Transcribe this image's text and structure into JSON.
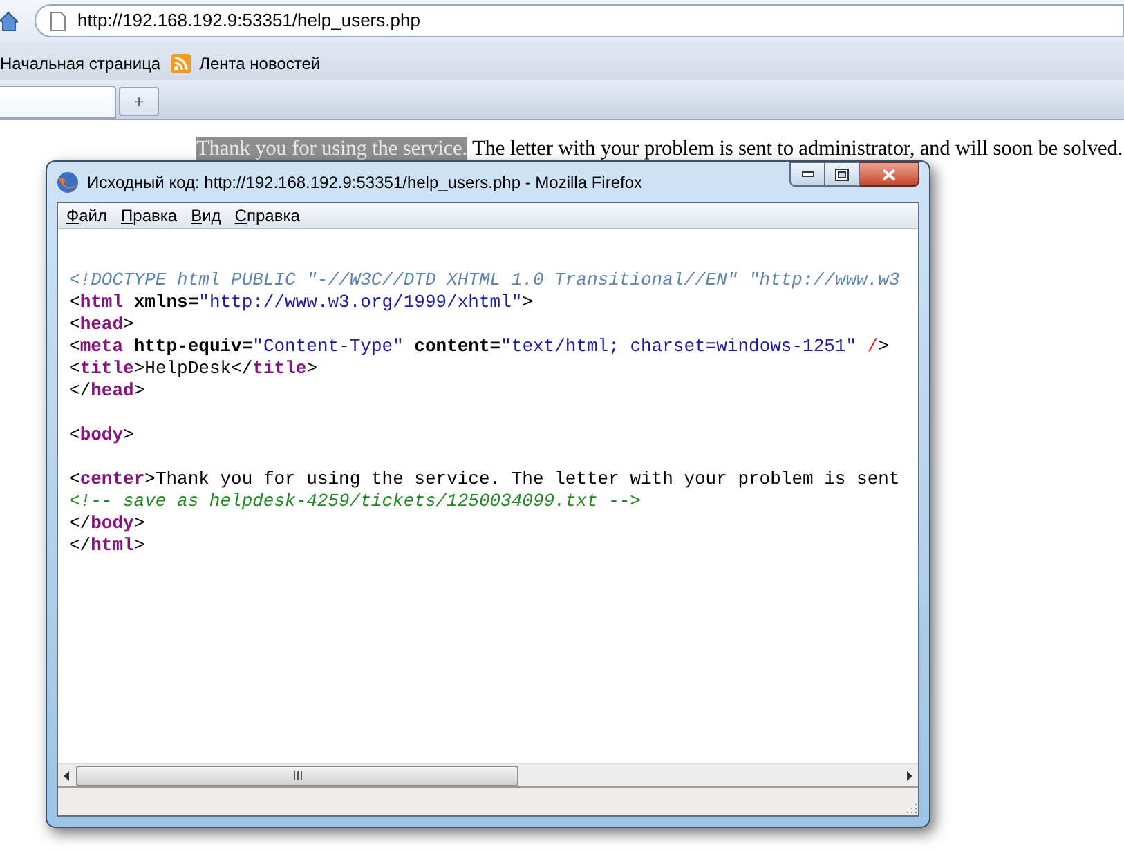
{
  "browser": {
    "address": "http://192.168.192.9:53351/help_users.php",
    "bookmarks": [
      "Начальная страница",
      "Лента новостей"
    ],
    "new_tab": "+"
  },
  "page": {
    "selected_text": "Thank you for using the service.",
    "text": "The letter with your problem is sent to administrator, and will soon be solved."
  },
  "source_window": {
    "title": "Исходный код: http://192.168.192.9:53351/help_users.php - Mozilla Firefox",
    "menu": [
      "Файл",
      "Правка",
      "Вид",
      "Справка"
    ],
    "lines": [
      {
        "kind": "blank"
      },
      {
        "kind": "code",
        "tokens": [
          {
            "kind": "doctype",
            "text": "<!DOCTYPE html PUBLIC \"-//W3C//DTD XHTML 1.0 Transitional//EN\" \"http://www.w3"
          }
        ]
      },
      {
        "kind": "code",
        "tokens": [
          {
            "kind": "punct",
            "text": "<"
          },
          {
            "kind": "tag",
            "text": "html"
          },
          {
            "kind": "attr",
            "text": " xmlns="
          },
          {
            "kind": "value",
            "text": "\"http://www.w3.org/1999/xhtml\""
          },
          {
            "kind": "punct",
            "text": ">"
          }
        ]
      },
      {
        "kind": "code",
        "tokens": [
          {
            "kind": "punct",
            "text": "<"
          },
          {
            "kind": "tag",
            "text": "head"
          },
          {
            "kind": "punct",
            "text": ">"
          }
        ]
      },
      {
        "kind": "code",
        "tokens": [
          {
            "kind": "punct",
            "text": "<"
          },
          {
            "kind": "tag",
            "text": "meta"
          },
          {
            "kind": "attr",
            "text": " http-equiv="
          },
          {
            "kind": "value",
            "text": "\"Content-Type\""
          },
          {
            "kind": "attr",
            "text": " content="
          },
          {
            "kind": "value",
            "text": "\"text/html; charset=windows-1251\""
          },
          {
            "kind": "error",
            "text": " /"
          },
          {
            "kind": "punct",
            "text": ">"
          }
        ]
      },
      {
        "kind": "code",
        "tokens": [
          {
            "kind": "punct",
            "text": "<"
          },
          {
            "kind": "tag",
            "text": "title"
          },
          {
            "kind": "punct",
            "text": ">"
          },
          {
            "kind": "text",
            "text": "HelpDesk"
          },
          {
            "kind": "punct",
            "text": "</"
          },
          {
            "kind": "tag",
            "text": "title"
          },
          {
            "kind": "punct",
            "text": ">"
          }
        ]
      },
      {
        "kind": "code",
        "tokens": [
          {
            "kind": "punct",
            "text": "</"
          },
          {
            "kind": "tag",
            "text": "head"
          },
          {
            "kind": "punct",
            "text": ">"
          }
        ]
      },
      {
        "kind": "blank"
      },
      {
        "kind": "code",
        "tokens": [
          {
            "kind": "punct",
            "text": "<"
          },
          {
            "kind": "tag",
            "text": "body"
          },
          {
            "kind": "punct",
            "text": ">"
          }
        ]
      },
      {
        "kind": "blank"
      },
      {
        "kind": "code",
        "tokens": [
          {
            "kind": "punct",
            "text": "<"
          },
          {
            "kind": "tag",
            "text": "center"
          },
          {
            "kind": "punct",
            "text": ">"
          },
          {
            "kind": "text",
            "text": "Thank you for using the service. The letter with your problem is sent"
          }
        ]
      },
      {
        "kind": "code",
        "tokens": [
          {
            "kind": "comment",
            "text": "<!-- save as helpdesk-4259/tickets/1250034099.txt -->"
          }
        ]
      },
      {
        "kind": "code",
        "tokens": [
          {
            "kind": "punct",
            "text": "</"
          },
          {
            "kind": "tag",
            "text": "body"
          },
          {
            "kind": "punct",
            "text": ">"
          }
        ]
      },
      {
        "kind": "code",
        "tokens": [
          {
            "kind": "punct",
            "text": "</"
          },
          {
            "kind": "tag",
            "text": "html"
          },
          {
            "kind": "punct",
            "text": ">"
          }
        ]
      }
    ]
  }
}
